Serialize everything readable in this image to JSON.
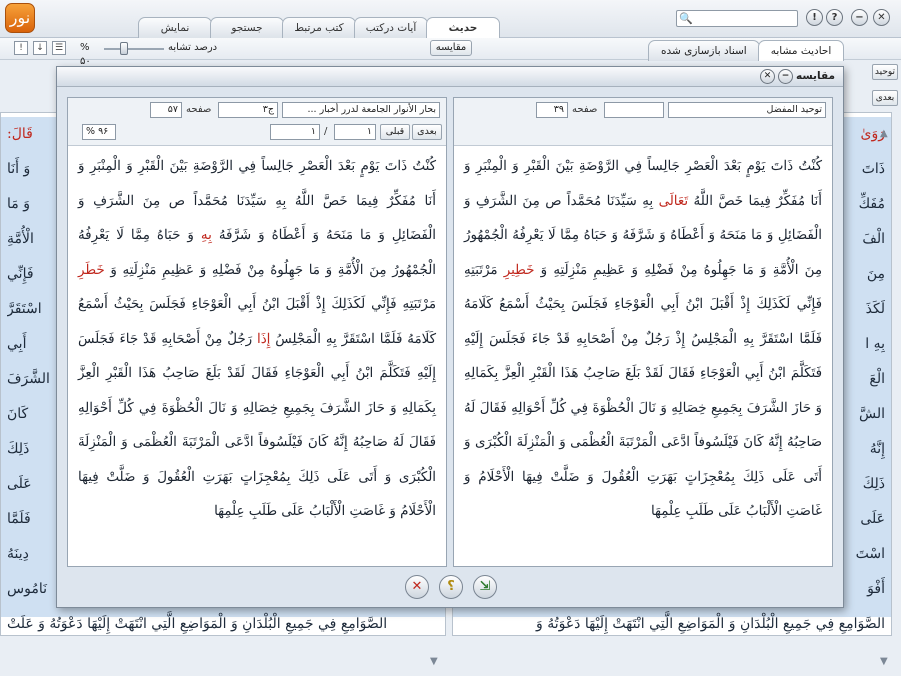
{
  "app": {
    "logo_text": "نور"
  },
  "window_controls": {
    "close": "✕",
    "minimize": "−",
    "help": "?",
    "info": "!"
  },
  "main_tabs": [
    {
      "label": "حدیث",
      "active": true
    },
    {
      "label": "آیات درکتب",
      "active": false
    },
    {
      "label": "کتب مرتبط",
      "active": false
    },
    {
      "label": "جستجو",
      "active": false
    },
    {
      "label": "نمایش",
      "active": false
    }
  ],
  "right_tabs": [
    {
      "label": "احادیث مشابه",
      "active": true
    },
    {
      "label": "اسناد بازسازی شده",
      "active": false
    }
  ],
  "toolbar": {
    "similarity_label": "درصد تشابه",
    "similarity_value": "۵۰",
    "pct_sign": "%",
    "compare_label": "مقایسه"
  },
  "dialog": {
    "title": "مقایسه",
    "right_doc": {
      "book": "توحید المفضل",
      "volume": "",
      "page_label": "صفحه",
      "page": "۳۹",
      "paragraphs": [
        {
          "text": "كُنْتُ ذَاتَ يَوْمٍ بَعْدَ الْعَصْرِ جَالِساً فِي الرَّوْضَةِ بَيْنَ الْقَبْرِ وَ الْمِنْبَرِ وَ أَنَا مُفَكِّرٌ فِيمَا خَصَّ اللَّهُ ",
          "red": false
        },
        {
          "text": "تَعَالَى",
          "red": true
        },
        {
          "text": " بِهِ سَيِّدَنَا مُحَمَّداً ص مِنَ الشَّرَفِ وَ الْفَضَائِلِ وَ مَا مَنَحَهُ وَ أَعْطَاهُ وَ شَرَّفَهُ وَ حَبَاهُ مِمَّا لَا يَعْرِفُهُ الْجُمْهُورُ مِنَ الْأُمَّةِ وَ مَا جَهِلُوهُ مِنْ فَضْلِهِ وَ عَظِيمِ مَنْزِلَتِهِ وَ ",
          "red": false
        },
        {
          "text": "خَطِيرِ",
          "red": true
        },
        {
          "text": " مَرْتَبَتِهِ فَإِنِّي لَكَذَلِكَ إِذْ أَقْبَلَ ابْنُ أَبِي الْعَوْجَاءِ فَجَلَسَ بِحَيْثُ أَسْمَعُ كَلَامَهُ فَلَمَّا اسْتَقَرَّ بِهِ الْمَجْلِسُ إِذْ رَجُلٌ مِنْ أَصْحَابِهِ قَدْ جَاءَ فَجَلَسَ إِلَيْهِ فَتَكَلَّمَ ابْنُ أَبِي الْعَوْجَاءِ فَقَالَ لَقَدْ بَلَغَ صَاحِبُ هَذَا الْقَبْرِ الْعِزَّ بِكَمَالِهِ وَ حَازَ الشَّرَفَ بِجَمِيعِ خِصَالِهِ وَ نَالَ الْحُظْوَةَ فِي كُلِّ أَحْوَالِهِ فَقَالَ لَهُ صَاحِبُهُ إِنَّهُ كَانَ فَيْلَسُوفاً ادَّعَى الْمَرْتَبَةَ الْعُظْمَى وَ الْمَنْزِلَةَ الْكُبْرَى وَ أَتَى عَلَى ذَلِكَ بِمُعْجِزَاتٍ بَهَرَتِ الْعُقُولَ وَ ضَلَّتْ فِيهَا الْأَحْلَامُ وَ غَاصَتِ الْأَلْبَابُ عَلَى طَلَبِ عِلْمِهَا",
          "red": false
        }
      ]
    },
    "left_doc": {
      "book": "بحار الأنوار الجامعة لدرر أخبار ...",
      "volume": "ج۳",
      "page_label": "صفحه",
      "page": "۵۷",
      "next_label": "بعدی",
      "prev_label": "قبلی",
      "current": "۱",
      "total": "۱",
      "percent": "۹۶",
      "pct_sign": "%",
      "paragraphs": [
        {
          "text": "كُنْتُ ذَاتَ يَوْمٍ بَعْدَ الْعَصْرِ جَالِساً فِي الرَّوْضَةِ بَيْنَ الْقَبْرِ وَ الْمِنْبَرِ وَ أَنَا مُفَكِّرٌ فِيمَا خَصَّ اللَّهُ بِهِ سَيِّدَنَا مُحَمَّداً ص مِنَ الشَّرَفِ وَ الْفَضَائِلِ وَ مَا مَنَحَهُ وَ أَعْطَاهُ وَ شَرَّفَهُ ",
          "red": false
        },
        {
          "text": "بِهِ",
          "red": true
        },
        {
          "text": " وَ حَبَاهُ مِمَّا لَا يَعْرِفُهُ الْجُمْهُورُ مِنَ الْأُمَّةِ وَ مَا جَهِلُوهُ مِنْ فَضْلِهِ وَ عَظِيمِ مَنْزِلَتِهِ وَ ",
          "red": false
        },
        {
          "text": "خَطَرِ",
          "red": true
        },
        {
          "text": " مَرْتَبَتِهِ فَإِنِّي لَكَذَلِكَ إِذْ أَقْبَلَ ابْنُ أَبِي الْعَوْجَاءِ فَجَلَسَ بِحَيْثُ أَسْمَعُ كَلَامَهُ فَلَمَّا اسْتَقَرَّ بِهِ الْمَجْلِسُ ",
          "red": false
        },
        {
          "text": "إِذَا",
          "red": true
        },
        {
          "text": " رَجُلٌ مِنْ أَصْحَابِهِ قَدْ جَاءَ فَجَلَسَ إِلَيْهِ فَتَكَلَّمَ ابْنُ أَبِي الْعَوْجَاءِ فَقَالَ لَقَدْ بَلَغَ صَاحِبُ هَذَا الْقَبْرِ الْعِزَّ بِكَمَالِهِ وَ حَازَ الشَّرَفَ بِجَمِيعِ خِصَالِهِ وَ نَالَ الْحُظْوَةَ فِي كُلِّ أَحْوَالِهِ فَقَالَ لَهُ صَاحِبُهُ إِنَّهُ كَانَ فَيْلَسُوفاً ادَّعَى الْمَرْتَبَةَ الْعُظْمَى وَ الْمَنْزِلَةَ الْكُبْرَى وَ أَتَى عَلَى ذَلِكَ بِمُعْجِزَاتٍ بَهَرَتِ الْعُقُولَ وَ ضَلَّتْ فِيهَا الْأَحْلَامُ وَ غَاصَتِ الْأَلْبَابُ عَلَى طَلَبِ عِلْمِهَا",
          "red": false
        }
      ]
    },
    "actions": {
      "close": "✕",
      "help": "؟",
      "export": "⇲"
    }
  },
  "background": {
    "right_pane": {
      "book": "توحيد",
      "next_label": "بعدی",
      "lines": [
        "رَوَىٰ",
        "ذَاتَ",
        "مُفَكِّ",
        "الْفَ",
        "مِنَ",
        "لَكَذَ",
        "بِهِ ا",
        "الْعَ",
        "الشَّ",
        "إِنَّهُ",
        "ذَلِكَ",
        "عَلَى",
        "اسْتَ",
        "أَفْوَ",
        "الصَّوَامِعِ فِي جَمِيعِ الْبُلْدَانِ وَ الْمَوَاضِعِ الَّتِي انْتَهَتْ إِلَيْهَا دَعْوَتُهُ وَ"
      ]
    },
    "left_pane": {
      "lines": [
        "قَالَ:",
        "وَ أَنَا",
        "وَ مَا",
        "الْأُمَّةِ",
        "فَإِنِّي",
        "اسْتَقَرَّ",
        "أَبِي",
        "الشَّرَفَ",
        "كَانَ",
        "ذَلِكَ",
        "عَلَى",
        "فَلَمَّا",
        "دِينَهُ",
        "نَامُوس",
        "الصَّوَامِعِ فِي جَمِيعِ الْبُلْدَانِ وَ الْمَوَاضِعِ الَّتِي انْتَهَتْ إِلَيْهَا دَعْوَتُهُ وَ عَلَتْ"
      ]
    }
  },
  "colors": {
    "highlight_bg": "#cfe0f2",
    "diff_text": "#c0281e",
    "dialog_bg": "#dde5ee"
  }
}
